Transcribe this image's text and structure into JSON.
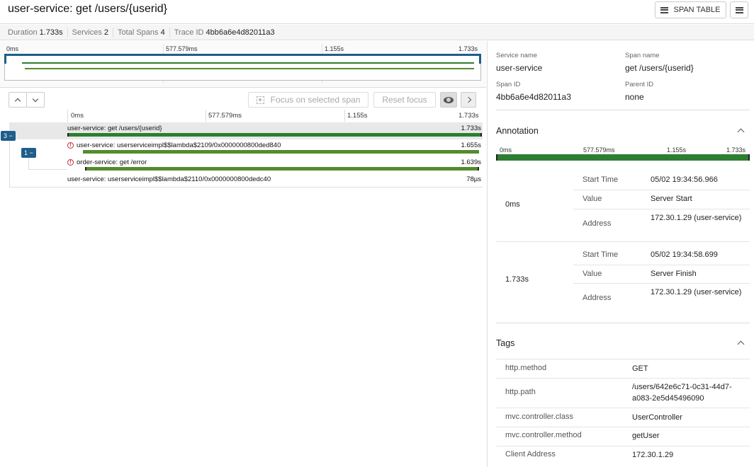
{
  "header": {
    "title": "user-service: get /users/{userid}",
    "span_table_label": "SPAN TABLE"
  },
  "summary": [
    {
      "label": "Duration",
      "value": "1.733s"
    },
    {
      "label": "Services",
      "value": "2"
    },
    {
      "label": "Total Spans",
      "value": "4"
    },
    {
      "label": "Trace ID",
      "value": "4bb6a6e4d82011a3"
    }
  ],
  "ticks": [
    "0ms",
    "577.579ms",
    "1.155s",
    "1.733s"
  ],
  "toolbar": {
    "focus_label": "Focus on selected span",
    "reset_label": "Reset focus"
  },
  "spans": [
    {
      "name": "user-service: get /users/{userid}",
      "duration": "1.733s",
      "start": 0,
      "end": 1.0,
      "error": false,
      "selected": true
    },
    {
      "name": "user-service: userserviceimpl$$lambda$2109/0x0000000800ded840",
      "duration": "1.655s",
      "start": 0.038,
      "end": 0.993,
      "error": true,
      "selected": false
    },
    {
      "name": "order-service: get /error",
      "duration": "1.639s",
      "start": 0.043,
      "end": 0.993,
      "error": true,
      "selected": false
    },
    {
      "name": "user-service: userserviceimpl$$lambda$2110/0x0000000800dedc40",
      "duration": "78µs",
      "start": 0.997,
      "end": 0.998,
      "error": false,
      "selected": false
    }
  ],
  "badges": [
    "3 −",
    "1 −"
  ],
  "colors": {
    "accent": "#1f5d8a",
    "bar_green": "#2e7d32",
    "bar_olive": "#558b2f",
    "error_red": "#c62828"
  },
  "detail": {
    "service_name_label": "Service name",
    "service_name": "user-service",
    "span_name_label": "Span name",
    "span_name": "get /users/{userid}",
    "span_id_label": "Span ID",
    "span_id": "4bb6a6e4d82011a3",
    "parent_id_label": "Parent ID",
    "parent_id": "none"
  },
  "annotation": {
    "title": "Annotation",
    "groups": [
      {
        "time": "0ms",
        "rows": [
          {
            "key": "Start Time",
            "value": "05/02 19:34:56.966"
          },
          {
            "key": "Value",
            "value": "Server Start"
          },
          {
            "key": "Address",
            "value": "172.30.1.29 (user-service)"
          }
        ]
      },
      {
        "time": "1.733s",
        "rows": [
          {
            "key": "Start Time",
            "value": "05/02 19:34:58.699"
          },
          {
            "key": "Value",
            "value": "Server Finish"
          },
          {
            "key": "Address",
            "value": "172.30.1.29 (user-service)"
          }
        ]
      }
    ]
  },
  "tags": {
    "title": "Tags",
    "rows": [
      {
        "key": "http.method",
        "value": "GET"
      },
      {
        "key": "http.path",
        "value": "/users/642e6c71-0c31-44d7-a083-2e5d45496090"
      },
      {
        "key": "mvc.controller.class",
        "value": "UserController"
      },
      {
        "key": "mvc.controller.method",
        "value": "getUser"
      },
      {
        "key": "Client Address",
        "value": "172.30.1.29"
      }
    ]
  }
}
